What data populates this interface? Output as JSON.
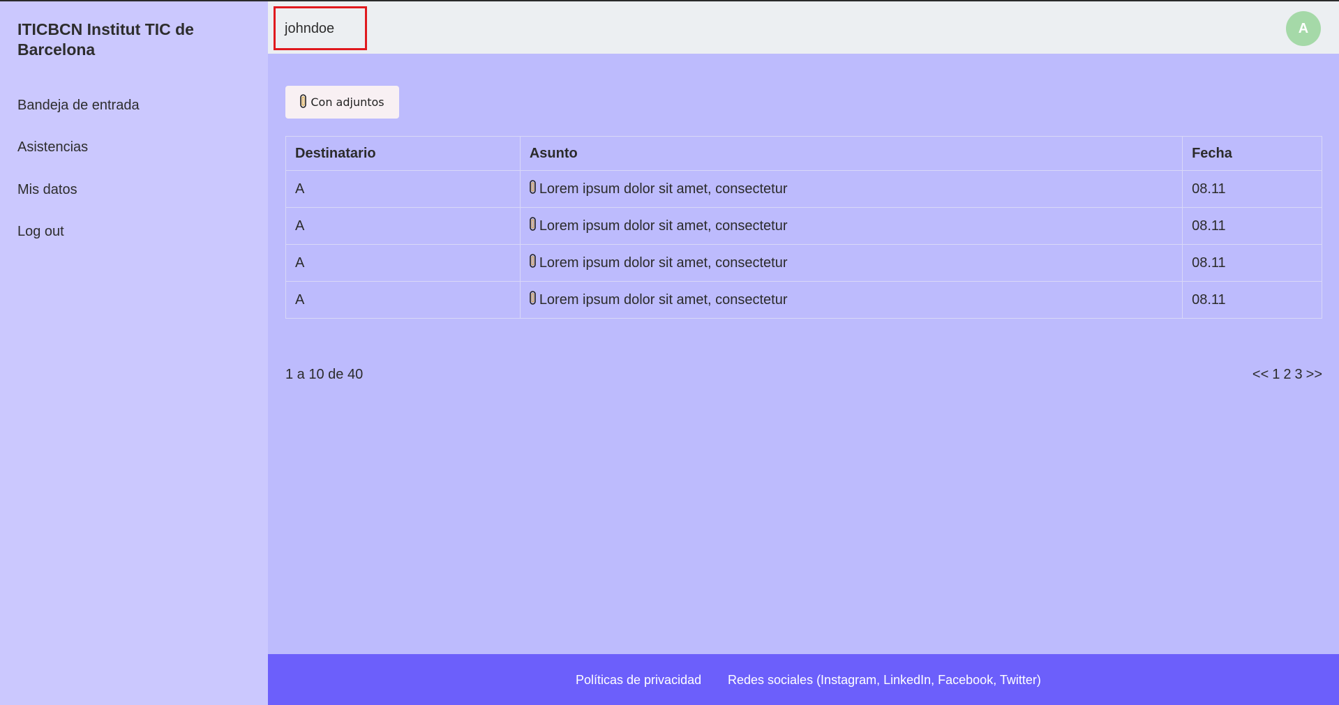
{
  "sidebar": {
    "brand": "ITICBCN Institut TIC de Barcelona",
    "items": [
      {
        "label": "Bandeja de entrada"
      },
      {
        "label": "Asistencias"
      },
      {
        "label": "Mis datos"
      },
      {
        "label": "Log out"
      }
    ]
  },
  "header": {
    "username": "johndoe",
    "avatar_initial": "A",
    "highlight_color": "#e0191e"
  },
  "filter": {
    "label": "Con adjuntos",
    "icon": "paperclip-icon"
  },
  "table": {
    "columns": [
      "Destinatario",
      "Asunto",
      "Fecha"
    ],
    "rows": [
      {
        "recipient": "A",
        "subject": "Lorem ipsum dolor sit amet, consectetur",
        "date": "08.11",
        "attachment": true
      },
      {
        "recipient": "A",
        "subject": "Lorem ipsum dolor sit amet, consectetur",
        "date": "08.11",
        "attachment": true
      },
      {
        "recipient": "A",
        "subject": "Lorem ipsum dolor sit amet, consectetur",
        "date": "08.11",
        "attachment": true
      },
      {
        "recipient": "A",
        "subject": "Lorem ipsum dolor sit amet, consectetur",
        "date": "08.11",
        "attachment": true
      }
    ]
  },
  "pagination": {
    "range_text": "1 a 10 de 40",
    "prev": "<<",
    "pages": [
      "1",
      "2",
      "3"
    ],
    "next": ">>"
  },
  "footer": {
    "privacy": "Políticas de privacidad",
    "social": "Redes sociales (Instagram, LinkedIn, Facebook, Twitter)"
  },
  "colors": {
    "sidebar_bg": "#cbc8fe",
    "main_bg": "#bdbbfd",
    "footer_bg": "#6c5ffb",
    "avatar_bg": "#a5d9a8"
  }
}
